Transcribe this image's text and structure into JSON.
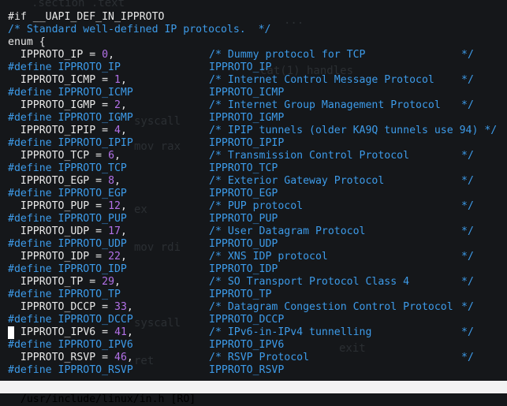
{
  "background_text": [
    ".section .text",
    "...",
    "cat(1) handles",
    "syscall",
    "mov rax",
    "ex",
    "mov rdi",
    "syscall",
    "ret",
    "exit"
  ],
  "code": {
    "header_lines": [
      "#if __UAPI_DEF_IN_IPPROTO",
      "/* Standard well-defined IP protocols.  */",
      "enum {"
    ],
    "entries": [
      {
        "name": "IPPROTO_IP",
        "value": "0",
        "comment": "/* Dummy protocol for TCP",
        "define": "#define IPPROTO_IP",
        "macro": "IPPROTO_IP"
      },
      {
        "name": "IPPROTO_ICMP",
        "value": "1",
        "comment": "/* Internet Control Message Protocol",
        "define": "#define IPPROTO_ICMP",
        "macro": "IPPROTO_ICMP"
      },
      {
        "name": "IPPROTO_IGMP",
        "value": "2",
        "comment": "/* Internet Group Management Protocol",
        "define": "#define IPPROTO_IGMP",
        "macro": "IPPROTO_IGMP"
      },
      {
        "name": "IPPROTO_IPIP",
        "value": "4",
        "comment": "/* IPIP tunnels (older KA9Q tunnels use 94) */",
        "define": "#define IPPROTO_IPIP",
        "macro": "IPPROTO_IPIP"
      },
      {
        "name": "IPPROTO_TCP",
        "value": "6",
        "comment": "/* Transmission Control Protocol",
        "define": "#define IPPROTO_TCP",
        "macro": "IPPROTO_TCP"
      },
      {
        "name": "IPPROTO_EGP",
        "value": "8",
        "comment": "/* Exterior Gateway Protocol",
        "define": "#define IPPROTO_EGP",
        "macro": "IPPROTO_EGP"
      },
      {
        "name": "IPPROTO_PUP",
        "value": "12",
        "comment": "/* PUP protocol",
        "define": "#define IPPROTO_PUP",
        "macro": "IPPROTO_PUP"
      },
      {
        "name": "IPPROTO_UDP",
        "value": "17",
        "comment": "/* User Datagram Protocol",
        "define": "#define IPPROTO_UDP",
        "macro": "IPPROTO_UDP"
      },
      {
        "name": "IPPROTO_IDP",
        "value": "22",
        "comment": "/* XNS IDP protocol",
        "define": "#define IPPROTO_IDP",
        "macro": "IPPROTO_IDP"
      },
      {
        "name": "IPPROTO_TP",
        "value": "29",
        "comment": "/* SO Transport Protocol Class 4",
        "define": "#define IPPROTO_TP",
        "macro": "IPPROTO_TP"
      },
      {
        "name": "IPPROTO_DCCP",
        "value": "33",
        "comment": "/* Datagram Congestion Control Protocol",
        "define": "#define IPPROTO_DCCP",
        "macro": "IPPROTO_DCCP"
      },
      {
        "name": "IPPROTO_IPV6",
        "value": "41",
        "comment": "/* IPv6-in-IPv4 tunnelling",
        "define": "#define IPPROTO_IPV6",
        "macro": "IPPROTO_IPV6"
      },
      {
        "name": "IPPROTO_RSVP",
        "value": "46",
        "comment": "/* RSVP Protocol",
        "define": "#define IPPROTO_RSVP",
        "macro": "IPPROTO_RSVP"
      }
    ],
    "comment_close": "*/"
  },
  "statusbar": {
    "text": "/usr/include/linux/in.h [RO]"
  },
  "colors": {
    "background": "#15171a",
    "define": "#3d9be9",
    "comment": "#3d9be9",
    "number": "#b371e8",
    "text": "#e8e8e8",
    "statusbar_bg": "#f2f2f2"
  }
}
